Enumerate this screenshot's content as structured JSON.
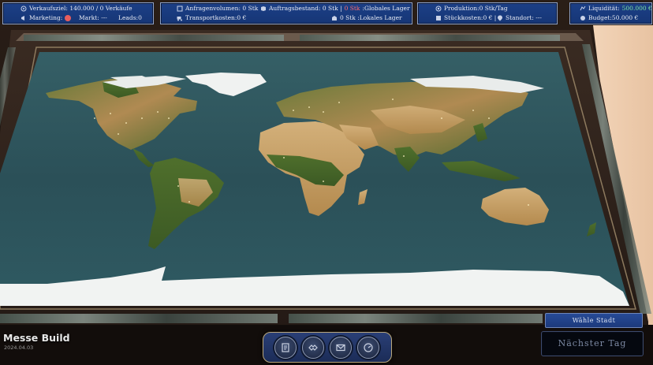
{
  "hud": {
    "sales": {
      "target_label": "Verkaufsziel: 140.000 / 0 Verkäufe",
      "marketing_label": "Marketing:",
      "market_label": "Markt: ---",
      "leads_label": "Leads:0",
      "marketing_status_color": "#e85d5d"
    },
    "orders": {
      "request_volume": "Anfragenvolumen: 0 Stk",
      "order_stock_prefix": "Auftragsbestand: 0 Stk |",
      "global_stock_value": "0 Stk",
      "global_stock_label": ":Globales Lager",
      "transport_costs": "Transportkosten:0 €",
      "local_stock": "0 Stk :Lokales Lager",
      "alert_color": "#ff6c6c"
    },
    "production": {
      "production_rate": "Produktion:0 Stk/Tag",
      "unit_cost": "Stückkosten:0 € |",
      "location": "Standort: ---"
    },
    "finance": {
      "liquidity_label": "Liquidität:",
      "liquidity_value": "500.000 €",
      "budget": "Budget:50.000 €",
      "liquidity_color": "#7fe3a0"
    }
  },
  "build": {
    "title": "Messe Build",
    "date": "2024.04.03"
  },
  "action_bar": {
    "items": [
      {
        "name": "documents-icon"
      },
      {
        "name": "handshake-icon"
      },
      {
        "name": "mail-icon"
      },
      {
        "name": "gauge-icon"
      }
    ]
  },
  "buttons": {
    "choose_city": "Wähle Stadt",
    "next_day": "Nächster Tag"
  }
}
